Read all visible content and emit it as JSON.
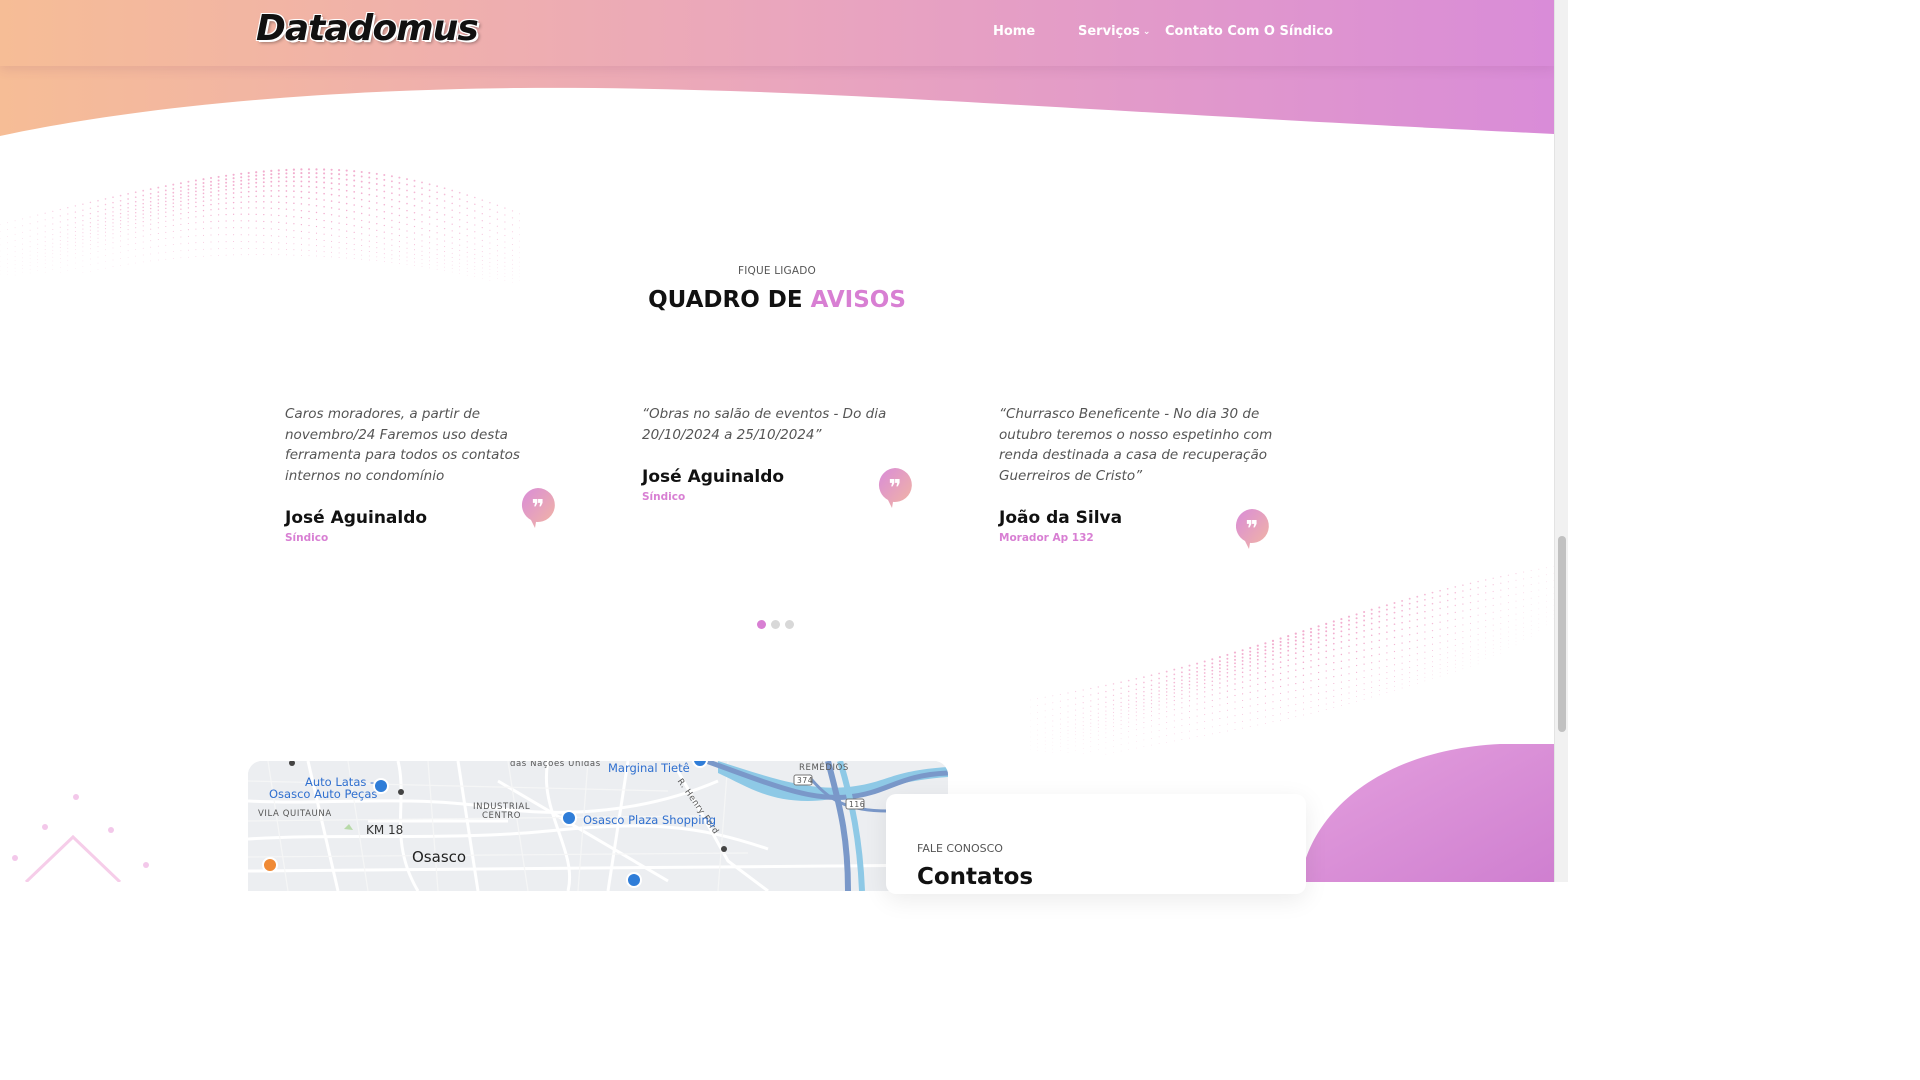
{
  "header": {
    "logo": "Datadomus",
    "nav": {
      "home": "Home",
      "servicos": "Serviços",
      "contato": "Contato Com O Síndico"
    }
  },
  "notices": {
    "eyebrow": "FIQUE LIGADO",
    "title_main": "QUADRO DE ",
    "title_accent": "AVISOS",
    "items": [
      {
        "text": "Caros moradores, a partir de novembro/24 Faremos uso desta ferramenta para todos os contatos internos no condomínio",
        "author": "José Aguinaldo",
        "role": "Síndico"
      },
      {
        "text": "“Obras no salão de eventos - Do dia 20/10/2024 a 25/10/2024”",
        "author": "José Aguinaldo",
        "role": "Síndico"
      },
      {
        "text": "“Churrasco Beneficente - No dia 30 de outubro teremos o nosso espetinho com renda destinada a casa de recuperação Guerreiros de Cristo”",
        "author": "João da Silva",
        "role": "Morador Ap 132"
      }
    ],
    "pager": {
      "count": 3,
      "active": 1
    }
  },
  "map": {
    "labels": {
      "auto_latas": "Auto Latas -",
      "osasco_auto_pecas": "Osasco Auto Peças",
      "vila_quitauna": "VILA QUITAUNA",
      "km18": "KM 18",
      "osasco": "Osasco",
      "industrial": "INDUSTRIAL",
      "centro": "CENTRO",
      "plaza": "Osasco Plaza Shopping",
      "marginal": "Marginal Tietê",
      "nacoes": "das Nações Unidas",
      "henry_ford": "R. Henry Ford",
      "remedios": "REMÉDIOS",
      "r374": "374",
      "r116": "116"
    }
  },
  "contact": {
    "eyebrow": "FALE CONOSCO",
    "title": "Contatos"
  },
  "colors": {
    "accent": "#d87fd3",
    "header_start": "#f5b99a",
    "header_end": "#d98cd8"
  }
}
